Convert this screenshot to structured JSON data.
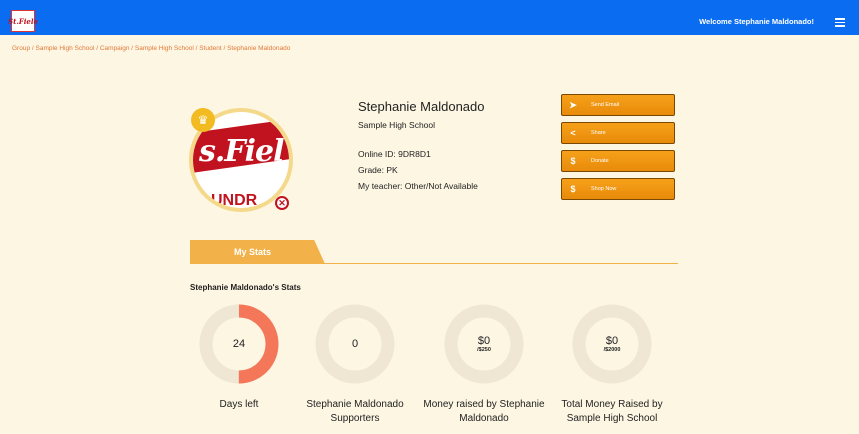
{
  "header": {
    "logo_text": "St.Fiele",
    "welcome": "Welcome Stephanie Maldonado!",
    "colors": {
      "bar": "#0a6cf0",
      "accent": "#f3b14a",
      "ring_progress": "#f4775a",
      "ring_track": "#efe6d4"
    }
  },
  "breadcrumb": {
    "items": [
      "Group",
      "Sample High School",
      "Campaign",
      "Sample High School",
      "Student",
      "Stephanie Maldonado"
    ],
    "separator": " / "
  },
  "avatar": {
    "brand_text": "s.Fiel",
    "bottom_text": "UNDR",
    "badge_icon": "crown-icon",
    "remove_icon": "close-icon"
  },
  "profile": {
    "name": "Stephanie Maldonado",
    "school": "Sample High School",
    "online_id": "Online ID: 9DR8D1",
    "grade": "Grade: PK",
    "teacher": "My teacher: Other/Not Available"
  },
  "actions": [
    {
      "label": "Send Email",
      "icon": "paper-plane-icon",
      "glyph": "➤"
    },
    {
      "label": "Share",
      "icon": "share-icon",
      "glyph": "<"
    },
    {
      "label": "Donate",
      "icon": "dollar-icon",
      "glyph": "$"
    },
    {
      "label": "Shop Now",
      "icon": "dollar-icon",
      "glyph": "$"
    }
  ],
  "tabs": [
    {
      "label": "My Stats",
      "active": true
    }
  ],
  "stats": {
    "title": "Stephanie Maldonado's Stats",
    "items": [
      {
        "value": "24",
        "sub": "",
        "label": "Days left",
        "progress": 0.5
      },
      {
        "value": "0",
        "sub": "",
        "label": "Stephanie Maldonado Supporters",
        "progress": 0
      },
      {
        "value": "$0",
        "sub": "/$250",
        "label": "Money raised by Stephanie Maldonado",
        "progress": 0
      },
      {
        "value": "$0",
        "sub": "/$2000",
        "label": "Total Money Raised by Sample High School",
        "progress": 0
      }
    ]
  }
}
